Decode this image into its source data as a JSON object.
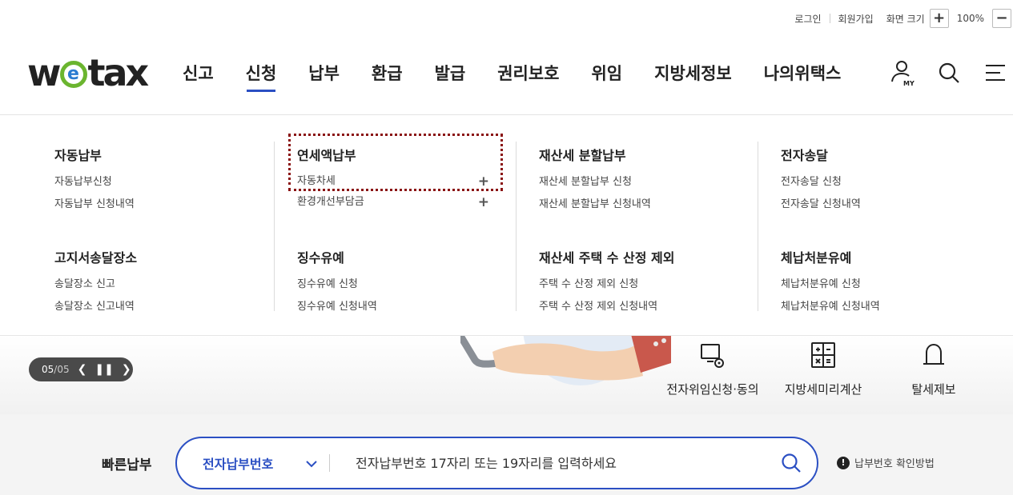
{
  "util": {
    "login": "로그인",
    "signup": "회원가입",
    "font_size_label": "화면 크기",
    "zoom_in": "+",
    "zoom_value": "100%",
    "zoom_out": "−"
  },
  "logo": {
    "pre": "w",
    "ring": "e",
    "post": "tax"
  },
  "gnb": [
    "신고",
    "신청",
    "납부",
    "환급",
    "발급",
    "권리보호",
    "위임",
    "지방세정보",
    "나의위택스"
  ],
  "gnb_active": "신청",
  "mega": {
    "col1": {
      "g1": {
        "title": "자동납부",
        "items": [
          "자동납부신청",
          "자동납부 신청내역"
        ]
      },
      "g2": {
        "title": "고지서송달장소",
        "items": [
          "송달장소 신고",
          "송달장소 신고내역"
        ]
      }
    },
    "col2": {
      "g1": {
        "title": "연세액납부",
        "items": [
          "자동차세",
          "환경개선부담금"
        ],
        "plus": "+"
      },
      "g2": {
        "title": "징수유예",
        "items": [
          "징수유예 신청",
          "징수유예 신청내역"
        ]
      }
    },
    "col3": {
      "g1": {
        "title": "재산세 분할납부",
        "items": [
          "재산세 분할납부 신청",
          "재산세 분할납부 신청내역"
        ]
      },
      "g2": {
        "title": "재산세 주택 수 산정 제외",
        "items": [
          "주택 수 산정 제외 신청",
          "주택 수 산정 제외 신청내역"
        ]
      }
    },
    "col4": {
      "g1": {
        "title": "전자송달",
        "items": [
          "전자송달 신청",
          "전자송달 신청내역"
        ]
      },
      "g2": {
        "title": "체납처분유예",
        "items": [
          "체납처분유예 신청",
          "체납처분유예 신청내역"
        ]
      }
    }
  },
  "slider": {
    "current": "05",
    "sep": "/",
    "total": "05"
  },
  "quicklinks": [
    "전자위임신청·동의",
    "지방세미리계산",
    "탈세제보"
  ],
  "quickpay": {
    "title": "빠른납부",
    "select_value": "전자납부번호",
    "placeholder": "전자납부번호 17자리 또는 19자리를 입력하세요",
    "help": "납부번호 확인방법"
  },
  "colors": {
    "accent": "#2b4fc3",
    "highlight": "#8a1313",
    "logo_green": "#6bb52f"
  },
  "icons": [
    "my-page-icon",
    "search-icon",
    "menu-icon",
    "chevron-down-icon",
    "monitor-lock-icon",
    "calculator-icon",
    "bell-icon"
  ]
}
